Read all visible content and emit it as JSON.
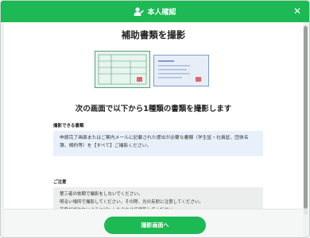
{
  "header": {
    "title": "本人確認",
    "icon": "person-check-icon",
    "close_icon": "close-icon"
  },
  "main": {
    "title": "補助書類を撮影",
    "instruction": "次の画面で以下から1種類の書類を撮影します",
    "documents_label": "撮影できる書類",
    "documents_text": "申請完了画面またはご案内メールに記載された提出が必要な書類（学生証・社員証、団体名簿、規約等）を【すべて】ご撮影ください。",
    "notes_label": "ご注意",
    "notes": [
      "第三者の依頼で撮影をしないでください。",
      "明るい場所で撮影してください。その際、光の反射に注意してください。",
      "画像がボケないようにピントを合わせて撮影してください。"
    ]
  },
  "footer": {
    "button_label": "撮影画面へ"
  },
  "colors": {
    "accent": "#1db954",
    "card_green": "#e6f5ee",
    "card_blue": "#e7eef8",
    "info_bg": "#e8f1fb"
  }
}
